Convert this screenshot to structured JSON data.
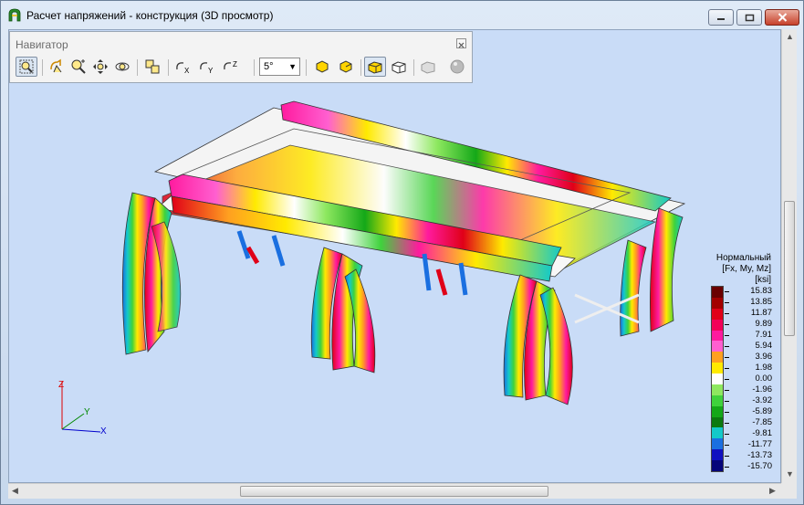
{
  "window": {
    "title": "Расчет напряжений - конструкция (3D просмотр)",
    "minimize_label": "minimize",
    "maximize_label": "maximize",
    "close_label": "close"
  },
  "navigator": {
    "title": "Навигатор",
    "angle_value": "5°",
    "tools": [
      {
        "name": "zoom-window",
        "icon": "zoom-window-icon",
        "active": true
      },
      {
        "name": "rotate",
        "icon": "rotate-icon"
      },
      {
        "name": "zoom-in-out",
        "icon": "zoom-icon"
      },
      {
        "name": "pan",
        "icon": "pan-icon"
      },
      {
        "name": "orbit",
        "icon": "orbit-icon"
      },
      {
        "name": "fit-all",
        "icon": "fit-all-icon"
      },
      {
        "name": "rotate-x",
        "icon": "rotate-x-icon"
      },
      {
        "name": "rotate-y",
        "icon": "rotate-y-icon"
      },
      {
        "name": "rotate-z",
        "icon": "rotate-z-icon"
      },
      {
        "name": "view-left",
        "icon": "view-left-icon"
      },
      {
        "name": "view-right",
        "icon": "view-right-icon"
      },
      {
        "name": "solid-view",
        "icon": "solid-view-icon",
        "active": true
      },
      {
        "name": "wireframe-view",
        "icon": "wireframe-view-icon"
      },
      {
        "name": "hidden-view",
        "icon": "hidden-view-icon",
        "disabled": true
      },
      {
        "name": "render-sphere",
        "icon": "sphere-icon",
        "disabled": true
      }
    ]
  },
  "legend": {
    "title_line1": "Нормальный",
    "title_line2": "[Fx, My, Mz]",
    "title_line3": "[ksi]",
    "values": [
      "15.83",
      "13.85",
      "11.87",
      "9.89",
      "7.91",
      "5.94",
      "3.96",
      "1.98",
      "0.00",
      "-1.96",
      "-3.92",
      "-5.89",
      "-7.85",
      "-9.81",
      "-11.77",
      "-13.73",
      "-15.70"
    ],
    "colors": [
      "#6a0000",
      "#a30000",
      "#e00018",
      "#f20058",
      "#ff1a9e",
      "#ff5fd0",
      "#ffa020",
      "#ffea00",
      "#ffffff",
      "#8ee860",
      "#3fd23c",
      "#14a818",
      "#0b7a0f",
      "#13c9c9",
      "#1a6fe0",
      "#1010c0",
      "#05057a"
    ]
  },
  "axes": {
    "x": "X",
    "y": "Y",
    "z": "Z"
  },
  "colors": {
    "background": "#c9dcf7",
    "accent": "#ff1a9e"
  }
}
